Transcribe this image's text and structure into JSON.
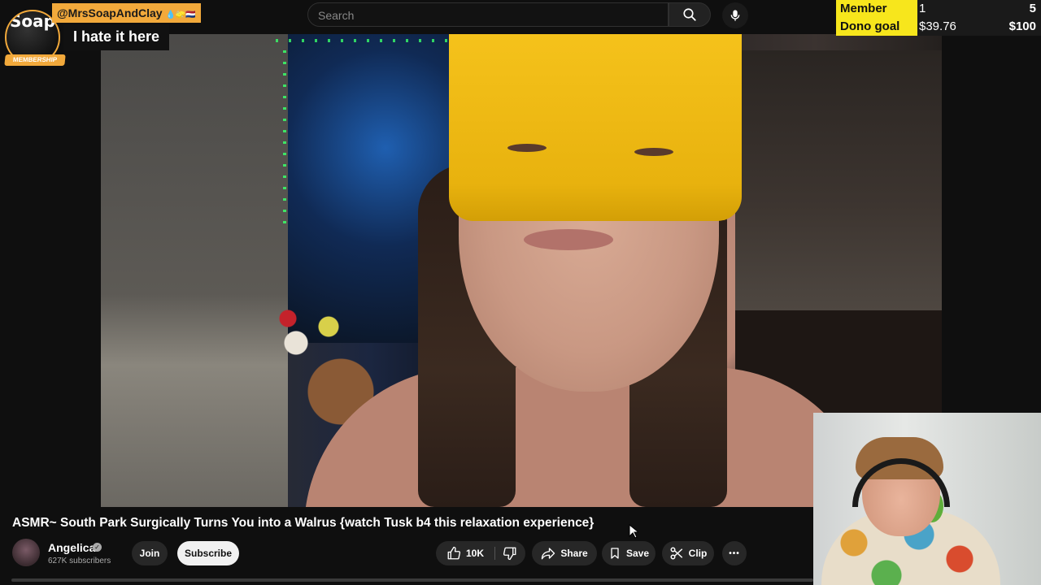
{
  "search": {
    "placeholder": "Search"
  },
  "chat_overlay": {
    "username": "@MrsSoapAndClay",
    "badge_glyphs": "💧🧽🇳🇱",
    "message": "I hate it here",
    "avatar_text": "Soap+Clay",
    "membership_label": "MEMBERSHIP"
  },
  "goals": [
    {
      "label": "Member Goal",
      "current": "1",
      "target": "5"
    },
    {
      "label": "Dono goal",
      "current": "$39.76",
      "target": "$100"
    }
  ],
  "video": {
    "title": "ASMR~ South Park Surgically Turns You into a Walrus {watch Tusk b4 this relaxation experience}",
    "channel": {
      "name": "Angelica",
      "subscribers": "627K subscribers",
      "verified_glyph": "✓"
    },
    "buttons": {
      "join": "Join",
      "subscribe": "Subscribe",
      "likes": "10K",
      "share": "Share",
      "save": "Save",
      "clip": "Clip",
      "more": "•••"
    }
  },
  "colors": {
    "accent": "#f2a93b",
    "goal_label_bg": "#f7e61c",
    "page_bg": "#0f0f0f"
  },
  "icons": [
    "search-icon",
    "microphone-icon",
    "thumbs-up-icon",
    "thumbs-down-icon",
    "share-icon",
    "bookmark-icon",
    "scissors-icon",
    "more-icon",
    "verified-icon",
    "cursor-icon"
  ]
}
